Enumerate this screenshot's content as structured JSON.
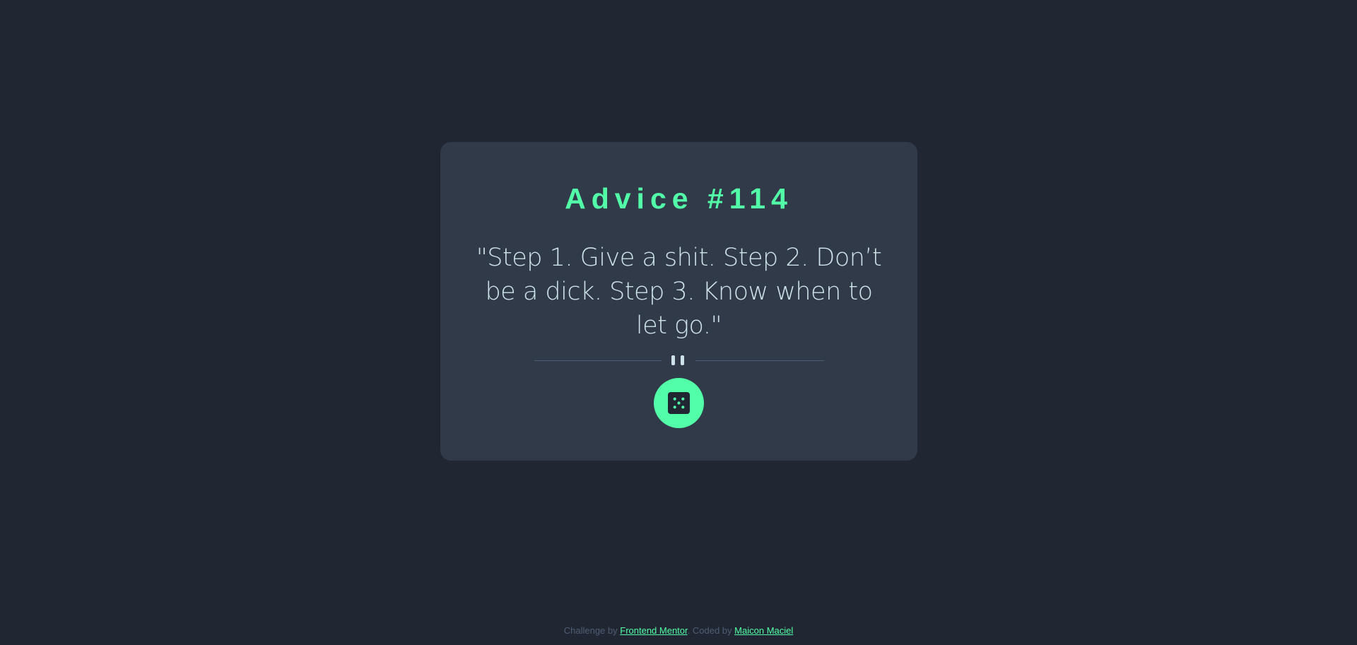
{
  "advice": {
    "title": "Advice #114",
    "text": "\"Step 1. Give a shit. Step 2. Don’t be a dick. Step 3. Know when to let go.\""
  },
  "icons": {
    "divider": "pause-icon",
    "button": "dice-icon"
  },
  "footer": {
    "challenge_prefix": "Challenge by",
    "challenge_link": "Frontend Mentor",
    "separator": ".",
    "coded_prefix": "Coded by",
    "coded_link": "Maicon Maciel"
  },
  "colors": {
    "background": "#202733",
    "card": "#313a49",
    "accent": "#52ffa8",
    "text": "#cee3e9",
    "muted": "#4f5d74"
  }
}
